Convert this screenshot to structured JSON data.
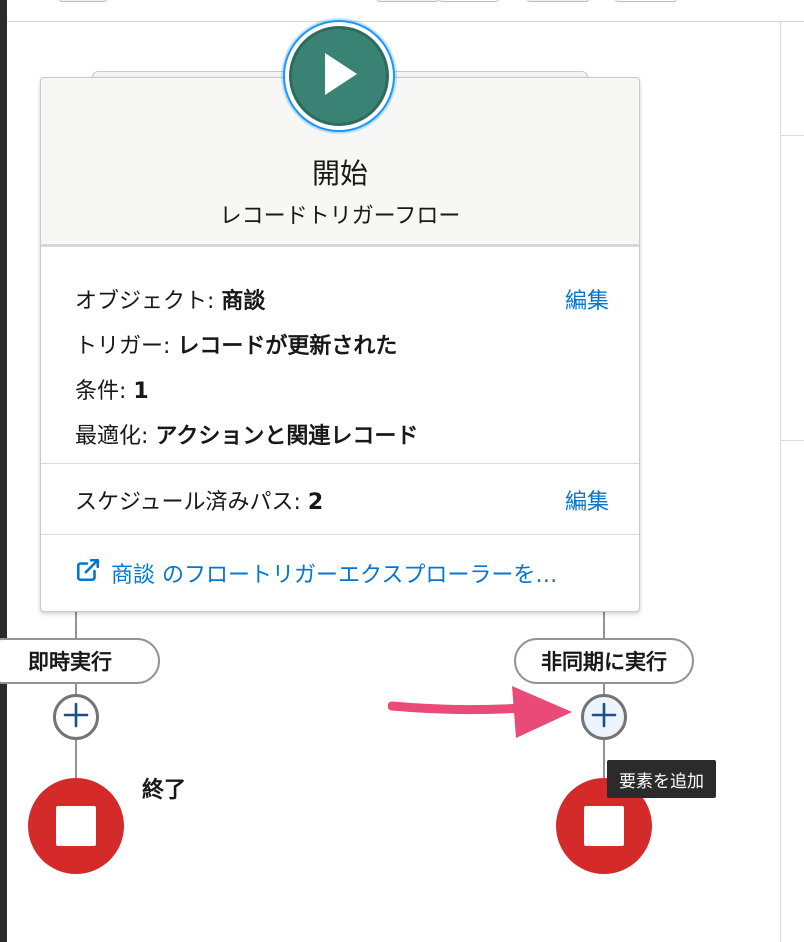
{
  "start_node": {
    "title": "開始",
    "subtitle": "レコードトリガーフロー",
    "icon": "play-icon",
    "color": "#3a8273"
  },
  "details": {
    "object_label": "オブジェクト:",
    "object_value": "商談",
    "trigger_label": "トリガー:",
    "trigger_value": "レコードが更新された",
    "condition_label": "条件:",
    "condition_value": "1",
    "optimize_label": "最適化:",
    "optimize_value": "アクションと関連レコード",
    "edit_label": "編集"
  },
  "scheduled": {
    "label": "スケジュール済みパス:",
    "value": "2",
    "edit_label": "編集"
  },
  "explorer_link": {
    "text": "商談 のフロートリガーエクスプローラーを…",
    "icon": "external-link-icon"
  },
  "paths": [
    {
      "label": "即時実行"
    },
    {
      "label": "非同期に実行"
    }
  ],
  "end_node": {
    "label": "終了",
    "color": "#d42a2a"
  },
  "tooltip": {
    "text": "要素を追加"
  },
  "colors": {
    "link": "#0176d3",
    "arrow": "#ea4a77",
    "connector": "#939393"
  }
}
